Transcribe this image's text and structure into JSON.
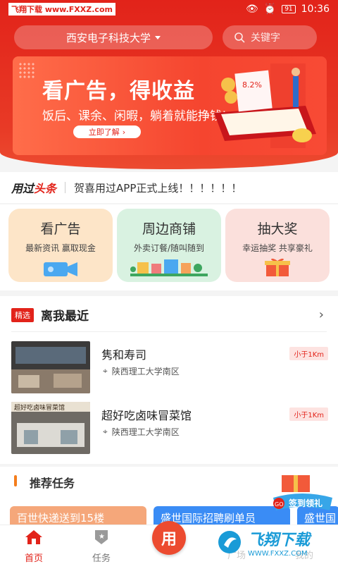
{
  "status": {
    "watermark": "飞翔下载 www.FXXZ.com",
    "battery": "91",
    "time": "10:36"
  },
  "header": {
    "school": "西安电子科技大学",
    "search_placeholder": "关键字"
  },
  "banner": {
    "title": "看广告，得收益",
    "subtitle": "饭后、课余、闲暇，躺着就能挣钱!",
    "button": "立即了解",
    "rate": "8.2%"
  },
  "headline": {
    "logo_a": "用过",
    "logo_b": "头条",
    "text": "贺喜用过APP正式上线！！！！！！"
  },
  "categories": [
    {
      "title": "看广告",
      "subtitle": "最新资讯 赢取现金"
    },
    {
      "title": "周边商铺",
      "subtitle": "外卖订餐/随叫随到"
    },
    {
      "title": "抽大奖",
      "subtitle": "幸运抽奖 共享豪礼"
    }
  ],
  "nearby": {
    "tag": "精选",
    "title": "离我最近",
    "shops": [
      {
        "name": "隽和寿司",
        "address": "陕西理工大学南区",
        "distance": "小于1Km"
      },
      {
        "name": "超好吃卤味冒菜馆",
        "address": "陕西理工大学南区",
        "distance": "小于1Km",
        "sign": "超好吃卤味冒菜馆"
      }
    ]
  },
  "tasks": {
    "title": "推荐任务",
    "items": [
      "百世快递送到15楼",
      "盛世国际招聘刷单员",
      "盛世国"
    ],
    "promo": "签到领礼",
    "promo_badge": "GO"
  },
  "tabbar": {
    "home": "首页",
    "task": "任务",
    "center": "用",
    "square": "广场",
    "mine": "我的"
  },
  "watermark2": {
    "big": "飞翔下载",
    "small": "WWW.FXXZ.COM"
  },
  "colors": {
    "brand_red": "#e2231a",
    "orange": "#f47d1c",
    "blue": "#3a8cf5"
  }
}
